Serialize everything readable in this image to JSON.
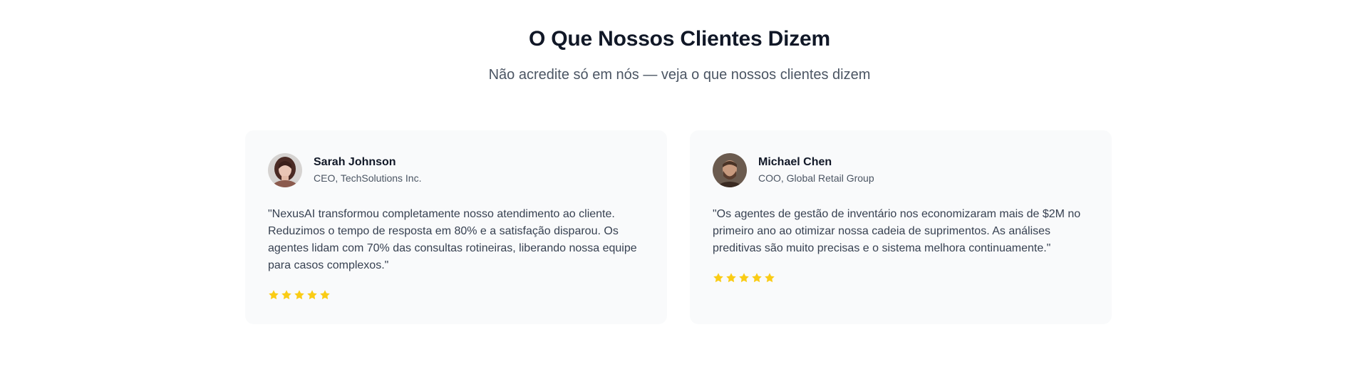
{
  "header": {
    "title": "O Que Nossos Clientes Dizem",
    "subtitle": "Não acredite só em nós — veja o que nossos clientes dizem"
  },
  "testimonials": [
    {
      "name": "Sarah Johnson",
      "role": "CEO, TechSolutions Inc.",
      "quote": "\"NexusAI transformou completamente nosso atendimento ao cliente. Reduzimos o tempo de resposta em 80% e a satisfação disparou. Os agentes lidam com 70% das consultas rotineiras, liberando nossa equipe para casos complexos.\"",
      "rating": 5
    },
    {
      "name": "Michael Chen",
      "role": "COO, Global Retail Group",
      "quote": "\"Os agentes de gestão de inventário nos economizaram mais de $2M no primeiro ano ao otimizar nossa cadeia de suprimentos. As análises preditivas são muito precisas e o sistema melhora continuamente.\"",
      "rating": 5
    }
  ],
  "colors": {
    "star": "#facc15",
    "title": "#111827",
    "card_bg": "#f9fafb"
  },
  "icons": {
    "star": "star-icon",
    "avatar": "avatar-photo"
  }
}
